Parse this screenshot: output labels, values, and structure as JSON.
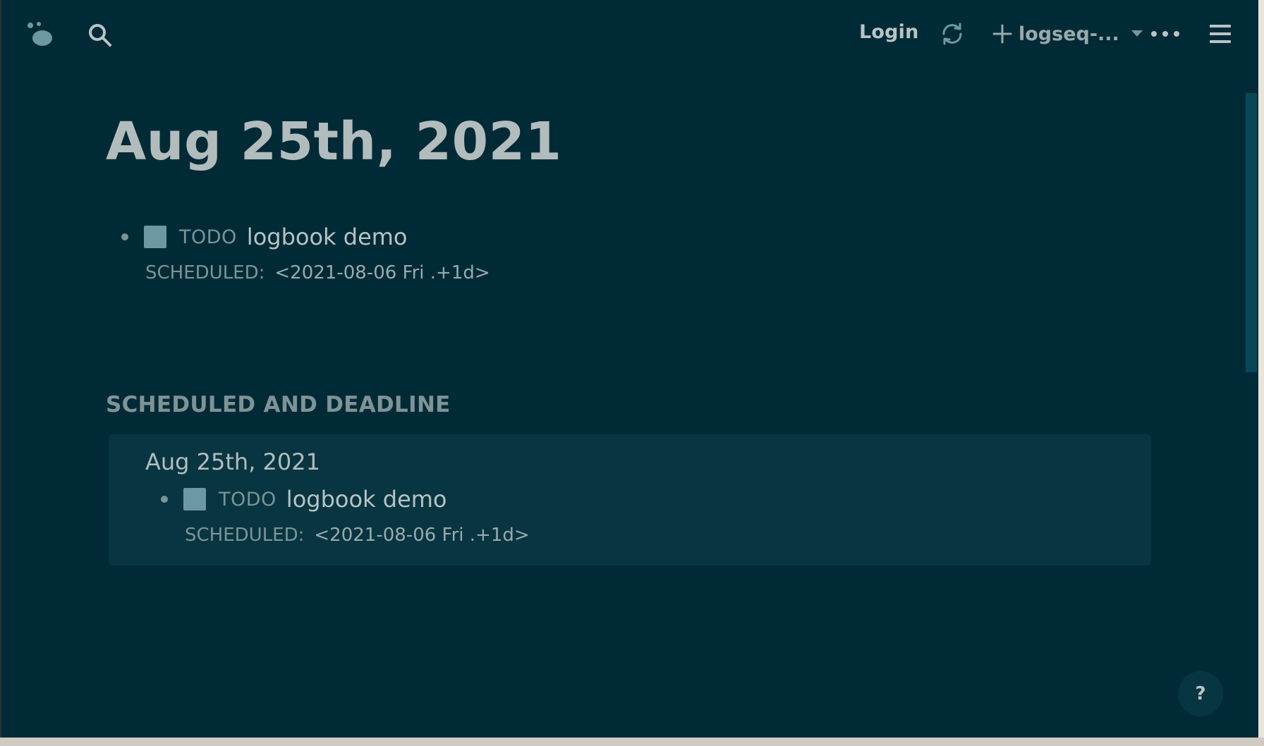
{
  "header": {
    "login_label": "Login",
    "repo_label": "logseq-..."
  },
  "page": {
    "title": "Aug 25th, 2021",
    "blocks": [
      {
        "marker": "TODO",
        "text": "logbook demo",
        "scheduled_label": "SCHEDULED:",
        "scheduled_value": "<2021-08-06 Fri .+1d>"
      }
    ]
  },
  "scheduled_section": {
    "title": "SCHEDULED AND DEADLINE",
    "groups": [
      {
        "title": "Aug 25th, 2021",
        "blocks": [
          {
            "marker": "TODO",
            "text": "logbook demo",
            "scheduled_label": "SCHEDULED:",
            "scheduled_value": "<2021-08-06 Fri .+1d>"
          }
        ]
      }
    ]
  },
  "help": {
    "label": "?"
  },
  "colors": {
    "background": "#002b36",
    "card": "#073642",
    "checkbox": "#6c98a4",
    "text": "#b7c3c4",
    "muted": "#7f9396"
  },
  "icons": [
    "logo-icon",
    "search-icon",
    "sync-icon",
    "plus-icon",
    "chevron-down-icon",
    "more-icon",
    "menu-icon"
  ]
}
